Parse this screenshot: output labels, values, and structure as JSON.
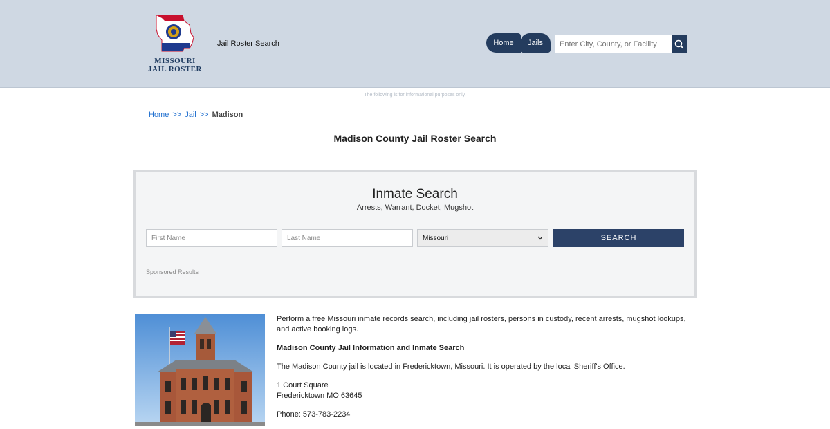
{
  "header": {
    "logo_line1": "MISSOURI",
    "logo_line2": "JAIL ROSTER",
    "tagline": "Jail Roster Search",
    "nav": [
      {
        "label": "Home"
      },
      {
        "label": "Jails"
      }
    ],
    "search_placeholder": "Enter City, County, or Facility"
  },
  "disclaimer": "The following is for informational purposes only.",
  "breadcrumb": {
    "home": "Home",
    "sep1": ">>",
    "jail": "Jail",
    "sep2": ">>",
    "current": "Madison"
  },
  "page_title": "Madison County Jail Roster Search",
  "panel": {
    "title": "Inmate Search",
    "subtitle": "Arrests, Warrant, Docket, Mugshot",
    "first_name_placeholder": "First Name",
    "last_name_placeholder": "Last Name",
    "state_selected": "Missouri",
    "search_label": "SEARCH",
    "sponsored": "Sponsored Results"
  },
  "content": {
    "intro": "Perform a free Missouri inmate records search, including jail rosters, persons in custody, recent arrests, mugshot lookups, and active booking logs.",
    "heading": "Madison County Jail Information and Inmate Search",
    "location": "The Madison County jail is located in Fredericktown, Missouri. It is operated by the local Sheriff's Office.",
    "address_line1": "1 Court Square",
    "address_line2": "Fredericktown MO 63645",
    "phone": "Phone: 573-783-2234"
  },
  "colors": {
    "header_bg": "#cfd8e3",
    "nav_bg": "#243c5e",
    "button_bg": "#2c4268",
    "link": "#1f6fcf"
  },
  "icons": [
    "missouri-state-logo-icon",
    "search-icon",
    "select-chevron-icon"
  ]
}
